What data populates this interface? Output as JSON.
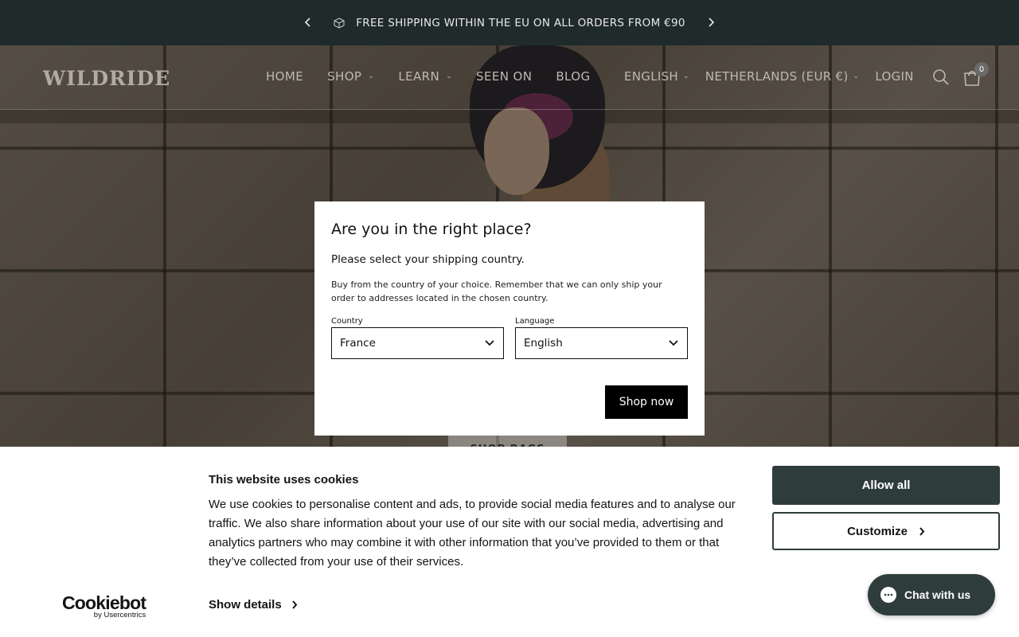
{
  "announcement": {
    "message": "FREE SHIPPING WITHIN THE EU ON ALL ORDERS FROM €90",
    "icon": "package-icon"
  },
  "header": {
    "logo": "WILDRIDE",
    "nav": [
      {
        "label": "HOME",
        "has_dropdown": false
      },
      {
        "label": "SHOP",
        "has_dropdown": true
      },
      {
        "label": "LEARN",
        "has_dropdown": true
      },
      {
        "label": "SEEN ON",
        "has_dropdown": false
      },
      {
        "label": "BLOG",
        "has_dropdown": false
      }
    ],
    "language": "ENGLISH",
    "region": "NETHERLANDS (EUR €)",
    "login": "LOGIN",
    "cart_count": "0"
  },
  "hero": {
    "button_label": "SHOP BAGS"
  },
  "modal": {
    "title": "Are you in the right place?",
    "subtitle": "Please select your shipping country.",
    "description": "Buy from the country of your choice. Remember that we can only ship your order to addresses located in the chosen country.",
    "country_label": "Country",
    "country_value": "France",
    "language_label": "Language",
    "language_value": "English",
    "submit_label": "Shop now"
  },
  "cookie": {
    "logo_brand": "Cookiebot",
    "logo_by": "by Usercentrics",
    "title": "This website uses cookies",
    "body": "We use cookies to personalise content and ads, to provide social media features and to analyse our traffic. We also share information about your use of our site with our social media, advertising and analytics partners who may combine it with other information that you’ve provided to them or that they’ve collected from your use of their services.",
    "details_label": "Show details",
    "allow_label": "Allow all",
    "customize_label": "Customize",
    "accent_color": "#2e3d3b"
  },
  "chat": {
    "label": "Chat with us"
  }
}
